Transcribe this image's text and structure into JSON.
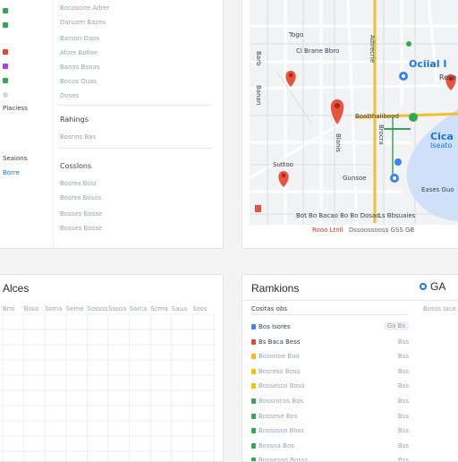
{
  "colors": {
    "map_pin": "#e8533f",
    "map_road": "#f2c02e",
    "map_water": "#cfe0fb",
    "map_poi_blue": "#3b82f6",
    "map_poi_green": "#34a853",
    "accent_blue": "#1a73e8",
    "footer_red": "#d93025",
    "dot_red": "#ea4335",
    "dot_orange": "#fbbc04",
    "dot_green": "#34a853",
    "dot_blue": "#4285f4"
  },
  "nav": {
    "sidebar": [
      {
        "icon": "green-square-icon",
        "label": ""
      },
      {
        "icon": "green-square-icon",
        "label": ""
      },
      {
        "icon": "red-square-icon",
        "label": ""
      },
      {
        "icon": "purple-square-icon",
        "label": ""
      },
      {
        "icon": "green-square-icon",
        "label": ""
      },
      {
        "icon": "gray-circle-icon",
        "label": ""
      },
      {
        "icon": "",
        "label": "Placiess"
      }
    ],
    "lower_sidebar": [
      "Seaions",
      "Borre"
    ],
    "items_top": [
      "Bocosoire Adrer",
      "Daruom Bazes",
      "Barson Daos",
      "Afore Bolloe",
      "Banos Bsnas",
      "Bocos Ouas",
      "Doses"
    ],
    "section1": {
      "heading": "Rahings",
      "items": [
        "Bosnns Bas"
      ]
    },
    "section2": {
      "heading": "Cosslons",
      "items": [
        "Bosres Bosr",
        "Bosres Bosos",
        "Bosses Bosse",
        "Bosses Bosse"
      ]
    }
  },
  "map": {
    "labels": {
      "top": "Togo",
      "crossing": "Cl Brane Bbro",
      "city": "Ociial I",
      "city_sub": "Rese",
      "street_h": "Bootthalibood",
      "water_name": "Cica",
      "water_sub": "Iseato",
      "lower_left": "Suttoo",
      "lower_mid": "Gunsoe",
      "bottom_street": "Bot Bo Bacao Bo Bo Dosao",
      "bottom_right": "Ls Bbsuaies",
      "water_small": "Eases Guo",
      "vertical_1": "Barb",
      "vertical_2": "Banan",
      "vertical_3": "Blanis",
      "vertical_4": "Adirecrie",
      "vertical_5": "Brocra"
    },
    "footer": {
      "left": "Rooo Ltnll",
      "right": "Dssoossooss GSS GB"
    }
  },
  "areas": {
    "title": "Alces",
    "columns": [
      "Bmi",
      "Bssa",
      "Ssma",
      "Seme",
      "Sossss",
      "Sssoa",
      "Sarca",
      "Scma",
      "Saua",
      "Soss"
    ]
  },
  "rankings": {
    "title": "Ramkions",
    "right_label": "GA",
    "subheader": {
      "left": "Cositas obs",
      "right": "Bosss Iace"
    },
    "rows": [
      {
        "label": "Bos Isores",
        "value": "Ga Bs",
        "dot": "blue",
        "pill": true
      },
      {
        "label": "Bs Baca Bess",
        "value": "Bss",
        "dot": "red",
        "pill": false
      },
      {
        "label": "Bosonoe Boo",
        "value": "Bss",
        "dot": "orange",
        "pill": false
      },
      {
        "label": "Bosreso Boss",
        "value": "Bss",
        "dot": "orange",
        "pill": false
      },
      {
        "label": "Bossesco Boso",
        "value": "Bss",
        "dot": "orange",
        "pill": false
      },
      {
        "label": "Bossrocos Bos",
        "value": "Bss",
        "dot": "green",
        "pill": false
      },
      {
        "label": "Bossese Bos",
        "value": "Bss",
        "dot": "green",
        "pill": false
      },
      {
        "label": "Bossosso Boss",
        "value": "Bss",
        "dot": "green",
        "pill": false
      },
      {
        "label": "Bossoa Bos",
        "value": "Bss",
        "dot": "green",
        "pill": false
      },
      {
        "label": "Bossesoo Bosss",
        "value": "Bss",
        "dot": "green",
        "pill": false
      }
    ]
  }
}
